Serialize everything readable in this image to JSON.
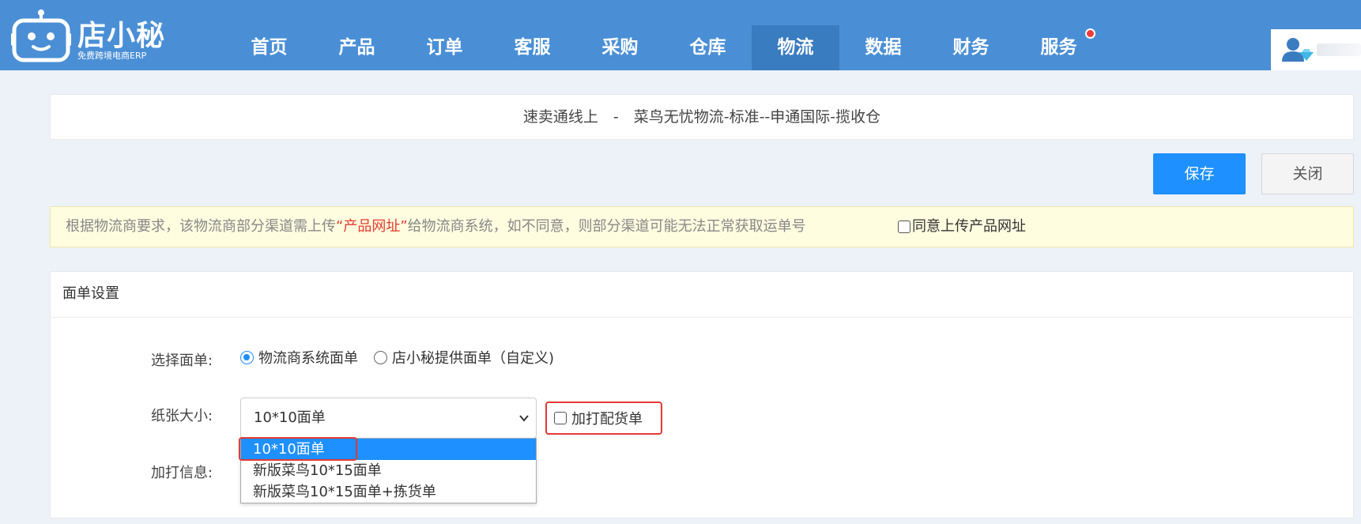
{
  "brand": {
    "name": "店小秘",
    "tagline": "免费跨境电商ERP"
  },
  "nav": {
    "items": [
      "首页",
      "产品",
      "订单",
      "客服",
      "采购",
      "仓库",
      "物流",
      "数据",
      "财务",
      "服务"
    ],
    "active": "物流"
  },
  "title": "速卖通线上　-　菜鸟无忧物流-标准--申通国际-揽收仓",
  "buttons": {
    "save": "保存",
    "close": "关闭"
  },
  "notice": {
    "before": "根据物流商要求，该物流商部分渠道需上传",
    "highlight": "“产品网址”",
    "after": "给物流商系统，如不同意，则部分渠道可能无法正常获取运单号",
    "agree_label": "同意上传产品网址",
    "agree_checked": false
  },
  "panel": {
    "title": "面单设置",
    "select_label_label": "选择面单:",
    "radio_options": [
      {
        "label": "物流商系统面单",
        "checked": true
      },
      {
        "label": "店小秘提供面单（自定义)",
        "checked": false
      }
    ],
    "paper_size_label": "纸张大小:",
    "paper_size_value": "10*10面单",
    "paper_size_options": [
      "10*10面单",
      "新版菜鸟10*15面单",
      "新版菜鸟10*15面单+拣货单"
    ],
    "extra_print_checkbox": "加打配货单",
    "extra_info_label": "加打信息:"
  },
  "colors": {
    "nav_bg": "#4a8fd6",
    "accent": "#1e90ff",
    "alert_red": "#e53935",
    "notice_bg": "#fefde0"
  }
}
